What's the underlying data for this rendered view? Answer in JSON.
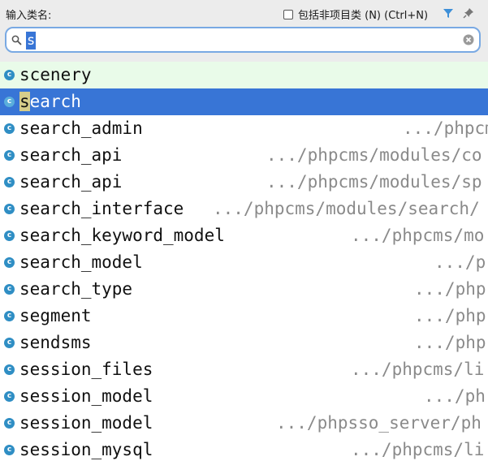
{
  "header": {
    "title": "输入类名:",
    "include_label": "包括非项目类 (N) (Ctrl+N)",
    "filter_icon": "filter-icon",
    "pin_icon": "pin-icon"
  },
  "search": {
    "value": "s",
    "search_icon": "search-icon",
    "clear_icon": "clear-icon"
  },
  "results": [
    {
      "name": "scenery",
      "path": ""
    },
    {
      "name": "search",
      "path": "",
      "match": "s",
      "rest": "earch"
    },
    {
      "name": "search_admin",
      "path": ".../phpcm"
    },
    {
      "name": "search_api",
      "path": ".../phpcms/modules/co"
    },
    {
      "name": "search_api",
      "path": ".../phpcms/modules/sp"
    },
    {
      "name": "search_interface",
      "path": ".../phpcms/modules/search/"
    },
    {
      "name": "search_keyword_model",
      "path": ".../phpcms/mo"
    },
    {
      "name": "search_model",
      "path": ".../p"
    },
    {
      "name": "search_type",
      "path": ".../php"
    },
    {
      "name": "segment",
      "path": ".../php"
    },
    {
      "name": "sendsms",
      "path": ".../php"
    },
    {
      "name": "session_files",
      "path": ".../phpcms/li"
    },
    {
      "name": "session_model",
      "path": ".../ph"
    },
    {
      "name": "session_model",
      "path": ".../phpsso_server/ph"
    },
    {
      "name": "session_mysql",
      "path": ".../phpcms/li"
    }
  ]
}
